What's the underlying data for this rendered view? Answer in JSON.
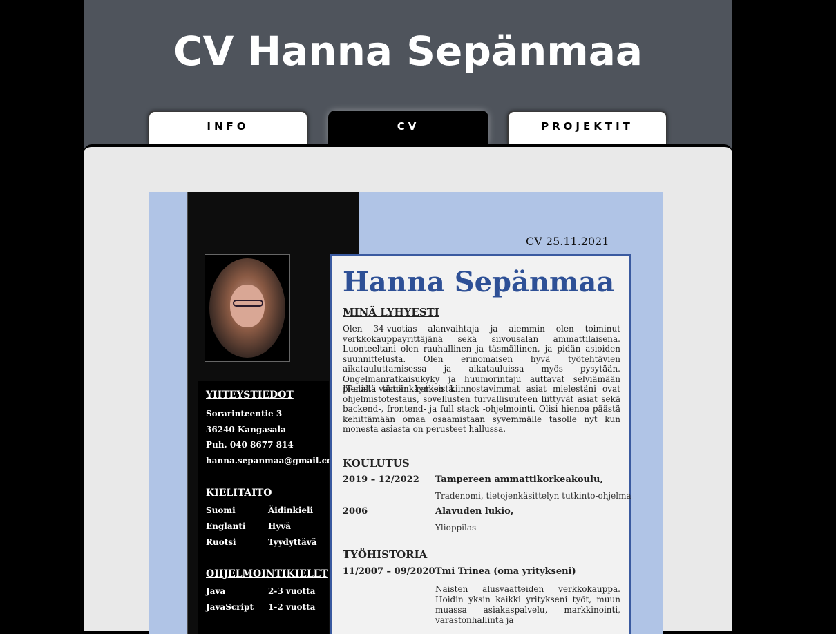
{
  "site": {
    "title": "CV Hanna Sepänmaa"
  },
  "nav": {
    "tabs": [
      {
        "label": "INFO"
      },
      {
        "label": "CV"
      },
      {
        "label": "PROJEKTIT"
      }
    ],
    "active": "CV"
  },
  "cv": {
    "date": "CV 25.11.2021",
    "name": "Hanna Sepänmaa",
    "contact": {
      "heading": "YHTEYSTIEDOT",
      "street": "Sorarinteentie 3",
      "city": "36240 Kangasala",
      "phone": "Puh. 040 8677 814",
      "email": "hanna.sepanmaa@gmail.com"
    },
    "languages": {
      "heading": "KIELITAITO",
      "items": [
        {
          "language": "Suomi",
          "level": "Äidinkieli"
        },
        {
          "language": "Englanti",
          "level": "Hyvä"
        },
        {
          "language": "Ruotsi",
          "level": "Tyydyttävä"
        }
      ]
    },
    "programming": {
      "heading": "OHJELMOINTIKIELET",
      "items": [
        {
          "language": "Java",
          "level": "2-3 vuotta"
        },
        {
          "language": "JavaScript",
          "level": "1-2 vuotta"
        }
      ]
    },
    "about": {
      "heading": "MINÄ LYHYESTI",
      "p1": "Olen 34-vuotias alanvaihtaja ja aiemmin olen toiminut verkkokauppayrittäjänä sekä siivousalan ammattilaisena. Luonteeltani olen rauhallinen ja täsmällinen, ja pidän asioiden suunnittelusta. Olen erinomaisen hyvä työtehtävien aikatauluttamisessa ja aikatauluissa myös pysytään. Ongelmanratkaisukyky ja huumorintaju auttavat selviämään pienistä vastoinkäymisistä.",
      "p2": "IT-alalla tämän hetken kiinnostavimmat asiat mielestäni ovat ohjelmistotestaus, sovellusten turvallisuuteen liittyvät asiat sekä backend-, frontend- ja full stack -ohjelmointi. Olisi hienoa päästä kehittämään omaa osaamistaan syvemmälle tasolle nyt kun monesta asiasta on perusteet hallussa."
    },
    "education": {
      "heading": "KOULUTUS",
      "items": [
        {
          "period": "2019 – 12/2022",
          "school": "Tampereen ammattikorkeakoulu,",
          "detail": "Tradenomi, tietojenkäsittelyn tutkinto-ohjelma"
        },
        {
          "period": "2006",
          "school": "Alavuden lukio,",
          "detail": "Ylioppilas"
        }
      ]
    },
    "work": {
      "heading": "TYÖHISTORIA",
      "items": [
        {
          "period": "11/2007 – 09/2020",
          "employer": "Tmi Trinea (oma yritykseni)",
          "description": "Naisten alusvaatteiden verkkokauppa. Hoidin yksin kaikki yritykseni työt, muun muassa asiakaspalvelu, markkinointi, varastonhallinta ja"
        }
      ]
    }
  }
}
